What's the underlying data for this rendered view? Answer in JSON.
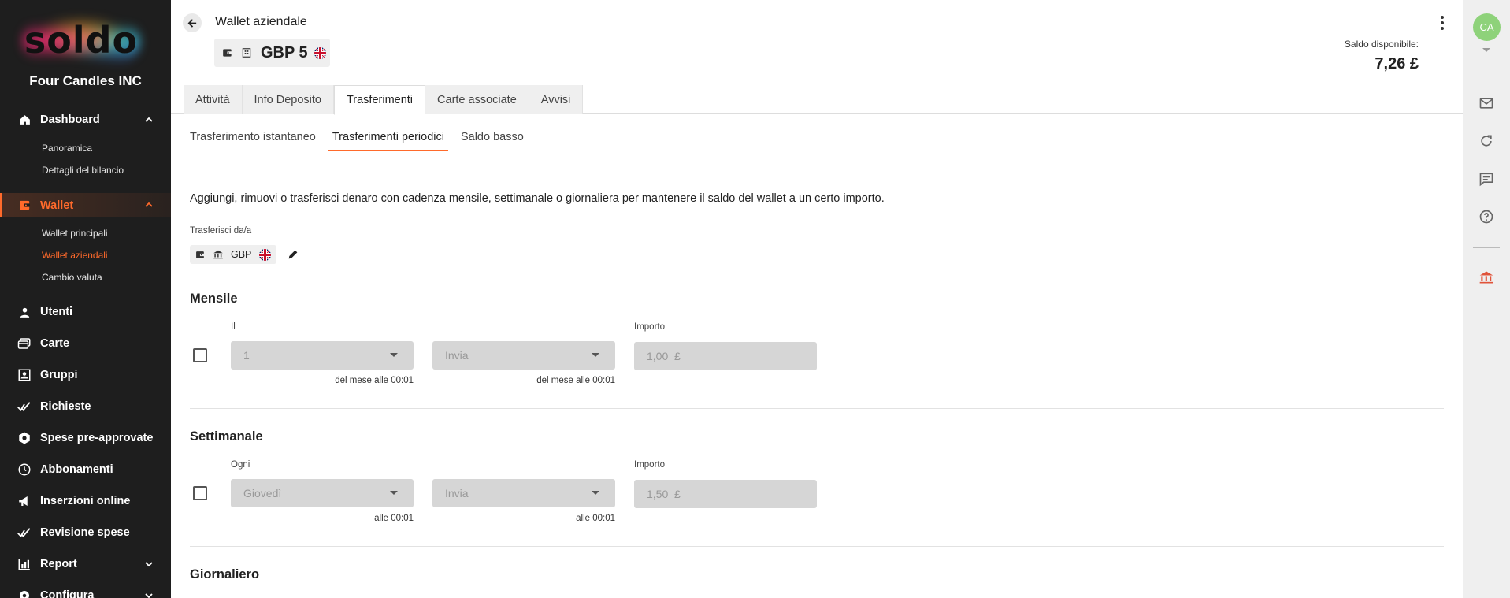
{
  "sidebar": {
    "logo_text": "soldo",
    "company": "Four Candles INC",
    "nav": [
      {
        "label": "Dashboard",
        "icon": "home-icon"
      },
      {
        "label": "Wallet",
        "icon": "wallet-icon"
      },
      {
        "label": "Utenti",
        "icon": "user-icon"
      },
      {
        "label": "Carte",
        "icon": "cards-icon"
      },
      {
        "label": "Gruppi",
        "icon": "groups-icon"
      },
      {
        "label": "Richieste",
        "icon": "double-check-icon"
      },
      {
        "label": "Spese pre-approvate",
        "icon": "hexagon-icon"
      },
      {
        "label": "Abbonamenti",
        "icon": "clock-icon"
      },
      {
        "label": "Inserzioni online",
        "icon": "megaphone-icon"
      },
      {
        "label": "Revisione spese",
        "icon": "double-check-icon"
      },
      {
        "label": "Report",
        "icon": "bar-chart-icon"
      },
      {
        "label": "Configura",
        "icon": "gear-icon"
      }
    ],
    "dashboard_sub": [
      "Panoramica",
      "Dettagli del bilancio"
    ],
    "wallet_sub": [
      "Wallet principali",
      "Wallet aziendali",
      "Cambio valuta"
    ],
    "accent": "#ff6a2b"
  },
  "header": {
    "title": "Wallet aziendale",
    "wallet_name": "GBP 5",
    "saldo_label": "Saldo disponibile:",
    "saldo_value": "7,26 £"
  },
  "tabs": [
    "Attività",
    "Info Deposito",
    "Trasferimenti",
    "Carte associate",
    "Avvisi"
  ],
  "active_tab": "Trasferimenti",
  "subtabs": [
    "Trasferimento istantaneo",
    "Trasferimenti periodici",
    "Saldo basso"
  ],
  "active_subtab": "Trasferimenti periodici",
  "content": {
    "description": "Aggiungi, rimuovi o trasferisci denaro con cadenza mensile, settimanale o giornaliera per mantenere il saldo del wallet a un certo importo.",
    "transfer_label": "Trasferisci da/a",
    "transfer_currency": "GBP",
    "monthly": {
      "title": "Mensile",
      "day_label": "Il",
      "day_value": "1",
      "day_hint": "del mese alle 00:01",
      "action_value": "Invia",
      "action_hint": "del mese alle 00:01",
      "amount_label": "Importo",
      "amount_value": "1,00",
      "currency_symbol": "£"
    },
    "weekly": {
      "title": "Settimanale",
      "day_label": "Ogni",
      "day_value": "Giovedì",
      "day_hint": "alle 00:01",
      "action_value": "Invia",
      "action_hint": "alle 00:01",
      "amount_label": "Importo",
      "amount_value": "1,50",
      "currency_symbol": "£"
    },
    "daily": {
      "title": "Giornaliero"
    }
  },
  "rail": {
    "avatar_initials": "CA",
    "icons": [
      "mail-icon",
      "refresh-icon",
      "chat-icon",
      "help-icon",
      "bank-icon"
    ]
  }
}
